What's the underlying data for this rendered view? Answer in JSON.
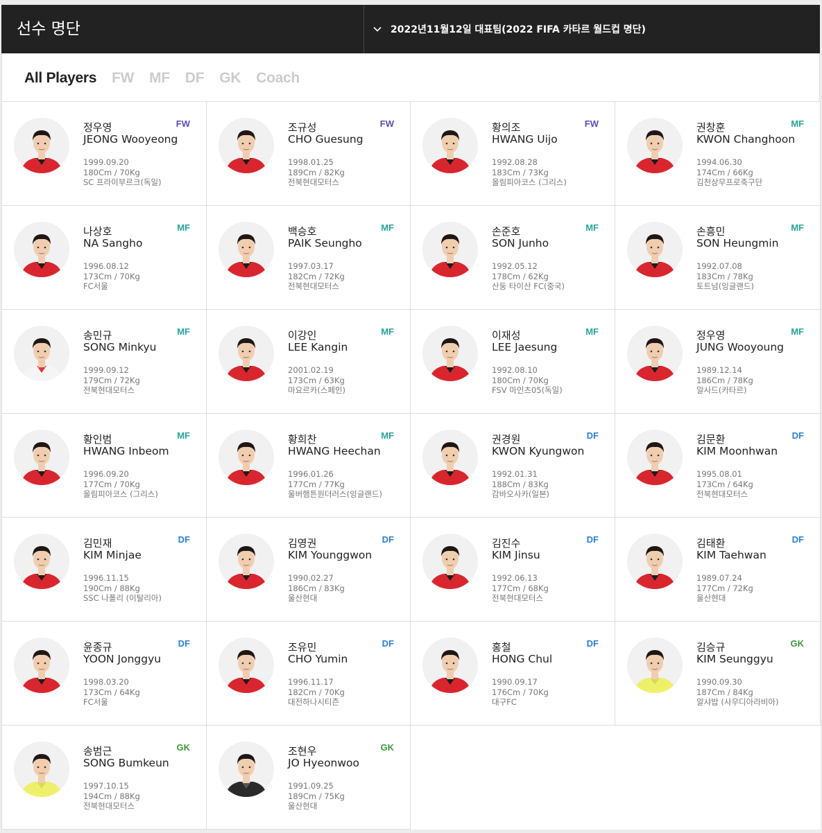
{
  "header": {
    "title": "선수 명단",
    "selector_label": "2022년11월12일 대표팀(2022 FIFA 카타르 월드컵 명단)"
  },
  "tabs": [
    "All Players",
    "FW",
    "MF",
    "DF",
    "GK",
    "Coach"
  ],
  "active_tab": "All Players",
  "colors": {
    "FW": "#5a4fb8",
    "MF": "#2aa39b",
    "DF": "#2d7fcf",
    "GK": "#3b9b3b",
    "header_bg": "#222222",
    "kit_red": "#d9262e",
    "kit_gk_yellow": "#eef06a"
  },
  "players": [
    {
      "kname": "정우영",
      "ename": "JEONG Wooyeong",
      "pos": "FW",
      "birth": "1999.09.20",
      "body": "180Cm / 70Kg",
      "club": "SC 프라이부르크(독일)",
      "kit": "red"
    },
    {
      "kname": "조규성",
      "ename": "CHO Guesung",
      "pos": "FW",
      "birth": "1998.01.25",
      "body": "189Cm / 82Kg",
      "club": "전북현대모터스",
      "kit": "red"
    },
    {
      "kname": "황의조",
      "ename": "HWANG Uijo",
      "pos": "FW",
      "birth": "1992.08.28",
      "body": "183Cm / 73Kg",
      "club": "올림피아코스 (그리스)",
      "kit": "red"
    },
    {
      "kname": "권창훈",
      "ename": "KWON Changhoon",
      "pos": "MF",
      "birth": "1994.06.30",
      "body": "174Cm / 66Kg",
      "club": "김천상무프로축구단",
      "kit": "red"
    },
    {
      "kname": "나상호",
      "ename": "NA Sangho",
      "pos": "MF",
      "birth": "1996.08.12",
      "body": "173Cm / 70Kg",
      "club": "FC서울",
      "kit": "red"
    },
    {
      "kname": "백승호",
      "ename": "PAIK Seungho",
      "pos": "MF",
      "birth": "1997.03.17",
      "body": "182Cm / 72Kg",
      "club": "전북현대모터스",
      "kit": "red"
    },
    {
      "kname": "손준호",
      "ename": "SON Junho",
      "pos": "MF",
      "birth": "1992.05.12",
      "body": "178Cm / 62Kg",
      "club": "산둥 타이산 FC(중국)",
      "kit": "red"
    },
    {
      "kname": "손흥민",
      "ename": "SON Heungmin",
      "pos": "MF",
      "birth": "1992.07.08",
      "body": "183Cm / 78Kg",
      "club": "토트넘(잉글랜드)",
      "kit": "red"
    },
    {
      "kname": "송민규",
      "ename": "SONG Minkyu",
      "pos": "MF",
      "birth": "1999.09.12",
      "body": "179Cm / 72Kg",
      "club": "전북현대모터스",
      "kit": "white"
    },
    {
      "kname": "이강인",
      "ename": "LEE Kangin",
      "pos": "MF",
      "birth": "2001.02.19",
      "body": "173Cm / 63Kg",
      "club": "마요르카(스페인)",
      "kit": "red"
    },
    {
      "kname": "이재성",
      "ename": "LEE Jaesung",
      "pos": "MF",
      "birth": "1992.08.10",
      "body": "180Cm / 70Kg",
      "club": "FSV 마인츠05(독일)",
      "kit": "red"
    },
    {
      "kname": "정우영",
      "ename": "JUNG Wooyoung",
      "pos": "MF",
      "birth": "1989.12.14",
      "body": "186Cm / 78Kg",
      "club": "알사드(카타르)",
      "kit": "red"
    },
    {
      "kname": "황인범",
      "ename": "HWANG Inbeom",
      "pos": "MF",
      "birth": "1996.09.20",
      "body": "177Cm / 70Kg",
      "club": "올림피아코스 (그리스)",
      "kit": "red"
    },
    {
      "kname": "황희찬",
      "ename": "HWANG Heechan",
      "pos": "MF",
      "birth": "1996.01.26",
      "body": "177Cm / 77Kg",
      "club": "울버햄튼원더러스(잉글랜드)",
      "kit": "red"
    },
    {
      "kname": "권경원",
      "ename": "KWON Kyungwon",
      "pos": "DF",
      "birth": "1992.01.31",
      "body": "188Cm / 83Kg",
      "club": "감바오사카(일본)",
      "kit": "red"
    },
    {
      "kname": "김문환",
      "ename": "KIM Moonhwan",
      "pos": "DF",
      "birth": "1995.08.01",
      "body": "173Cm / 64Kg",
      "club": "전북현대모터스",
      "kit": "red"
    },
    {
      "kname": "김민재",
      "ename": "KIM Minjae",
      "pos": "DF",
      "birth": "1996.11.15",
      "body": "190Cm / 88Kg",
      "club": "SSC 나폴리 (이탈리아)",
      "kit": "red"
    },
    {
      "kname": "김영권",
      "ename": "KIM Younggwon",
      "pos": "DF",
      "birth": "1990.02.27",
      "body": "186Cm / 83Kg",
      "club": "울산현대",
      "kit": "red"
    },
    {
      "kname": "김진수",
      "ename": "KIM Jinsu",
      "pos": "DF",
      "birth": "1992.06.13",
      "body": "177Cm / 68Kg",
      "club": "전북현대모터스",
      "kit": "red"
    },
    {
      "kname": "김태환",
      "ename": "KIM Taehwan",
      "pos": "DF",
      "birth": "1989.07.24",
      "body": "177Cm / 72Kg",
      "club": "울산현대",
      "kit": "red"
    },
    {
      "kname": "윤종규",
      "ename": "YOON Jonggyu",
      "pos": "DF",
      "birth": "1998.03.20",
      "body": "173Cm / 64Kg",
      "club": "FC서울",
      "kit": "red"
    },
    {
      "kname": "조유민",
      "ename": "CHO Yumin",
      "pos": "DF",
      "birth": "1996.11.17",
      "body": "182Cm / 70Kg",
      "club": "대전하나시티즌",
      "kit": "red"
    },
    {
      "kname": "홍철",
      "ename": "HONG Chul",
      "pos": "DF",
      "birth": "1990.09.17",
      "body": "176Cm / 70Kg",
      "club": "대구FC",
      "kit": "red"
    },
    {
      "kname": "김승규",
      "ename": "KIM Seunggyu",
      "pos": "GK",
      "birth": "1990.09.30",
      "body": "187Cm / 84Kg",
      "club": "알샤밥 (사우디아라비아)",
      "kit": "yellow"
    },
    {
      "kname": "송범근",
      "ename": "SONG Bumkeun",
      "pos": "GK",
      "birth": "1997.10.15",
      "body": "194Cm / 88Kg",
      "club": "전북현대모터스",
      "kit": "yellow"
    },
    {
      "kname": "조현우",
      "ename": "JO Hyeonwoo",
      "pos": "GK",
      "birth": "1991.09.25",
      "body": "189Cm / 75Kg",
      "club": "울산현대",
      "kit": "black"
    }
  ]
}
